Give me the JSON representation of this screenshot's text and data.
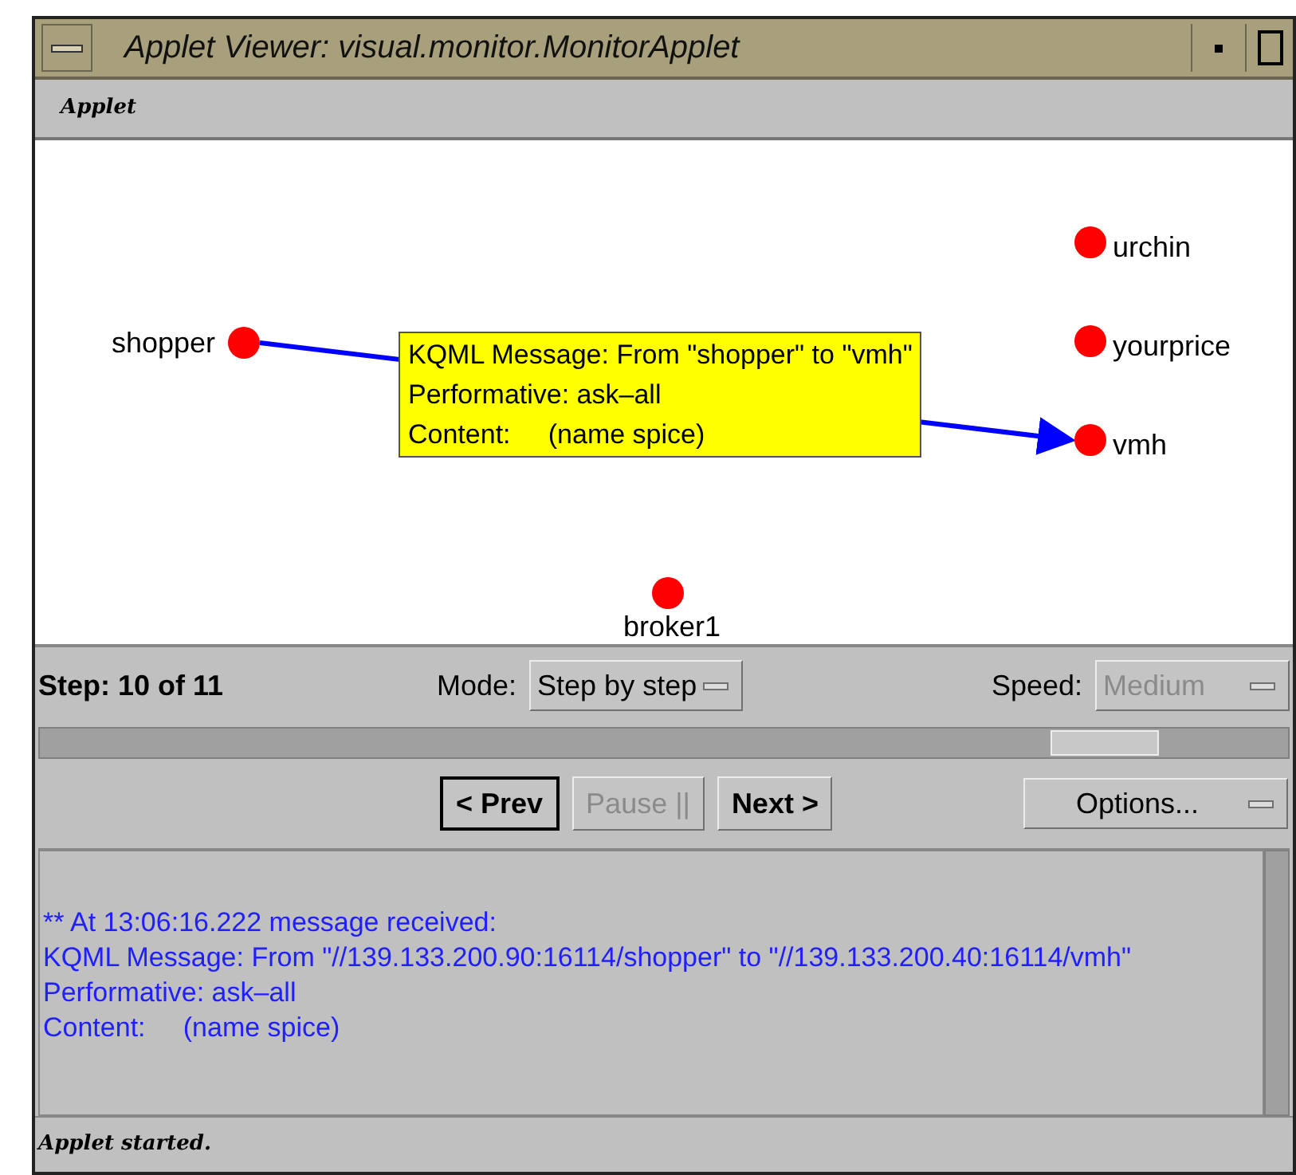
{
  "window": {
    "title": "Applet Viewer: visual.monitor.MonitorApplet"
  },
  "menu": [
    {
      "label": "Applet"
    }
  ],
  "nodes": [
    {
      "name": "shopper"
    },
    {
      "name": "urchin"
    },
    {
      "name": "yourprice"
    },
    {
      "name": "vmh"
    },
    {
      "name": "broker1"
    }
  ],
  "message": {
    "lines": [
      "KQML Message: From \"shopper\" to \"vmh\"",
      "Performative: ask–all",
      "Content:     (name spice)"
    ]
  },
  "controls": {
    "step": "Step: 10 of 11",
    "mode_label": "Mode:",
    "mode": {
      "value": "Step by step",
      "disabled": false
    },
    "speed_label": "Speed:",
    "speed": {
      "value": "Medium",
      "disabled": true
    }
  },
  "buttons": [
    {
      "label": "< Prev",
      "disabled": false,
      "focused": true
    },
    {
      "label": "Pause ||",
      "disabled": true,
      "focused": false
    },
    {
      "label": "Next >",
      "disabled": false,
      "focused": false
    }
  ],
  "options": {
    "value": "Options..."
  },
  "log": [
    "** At 13:06:16.222 message received:",
    "KQML Message: From \"//139.133.200.90:16114/shopper\" to \"//139.133.200.40:16114/vmh\"",
    "Performative: ask–all",
    "Content:     (name spice)"
  ],
  "status_bar": "Applet started."
}
